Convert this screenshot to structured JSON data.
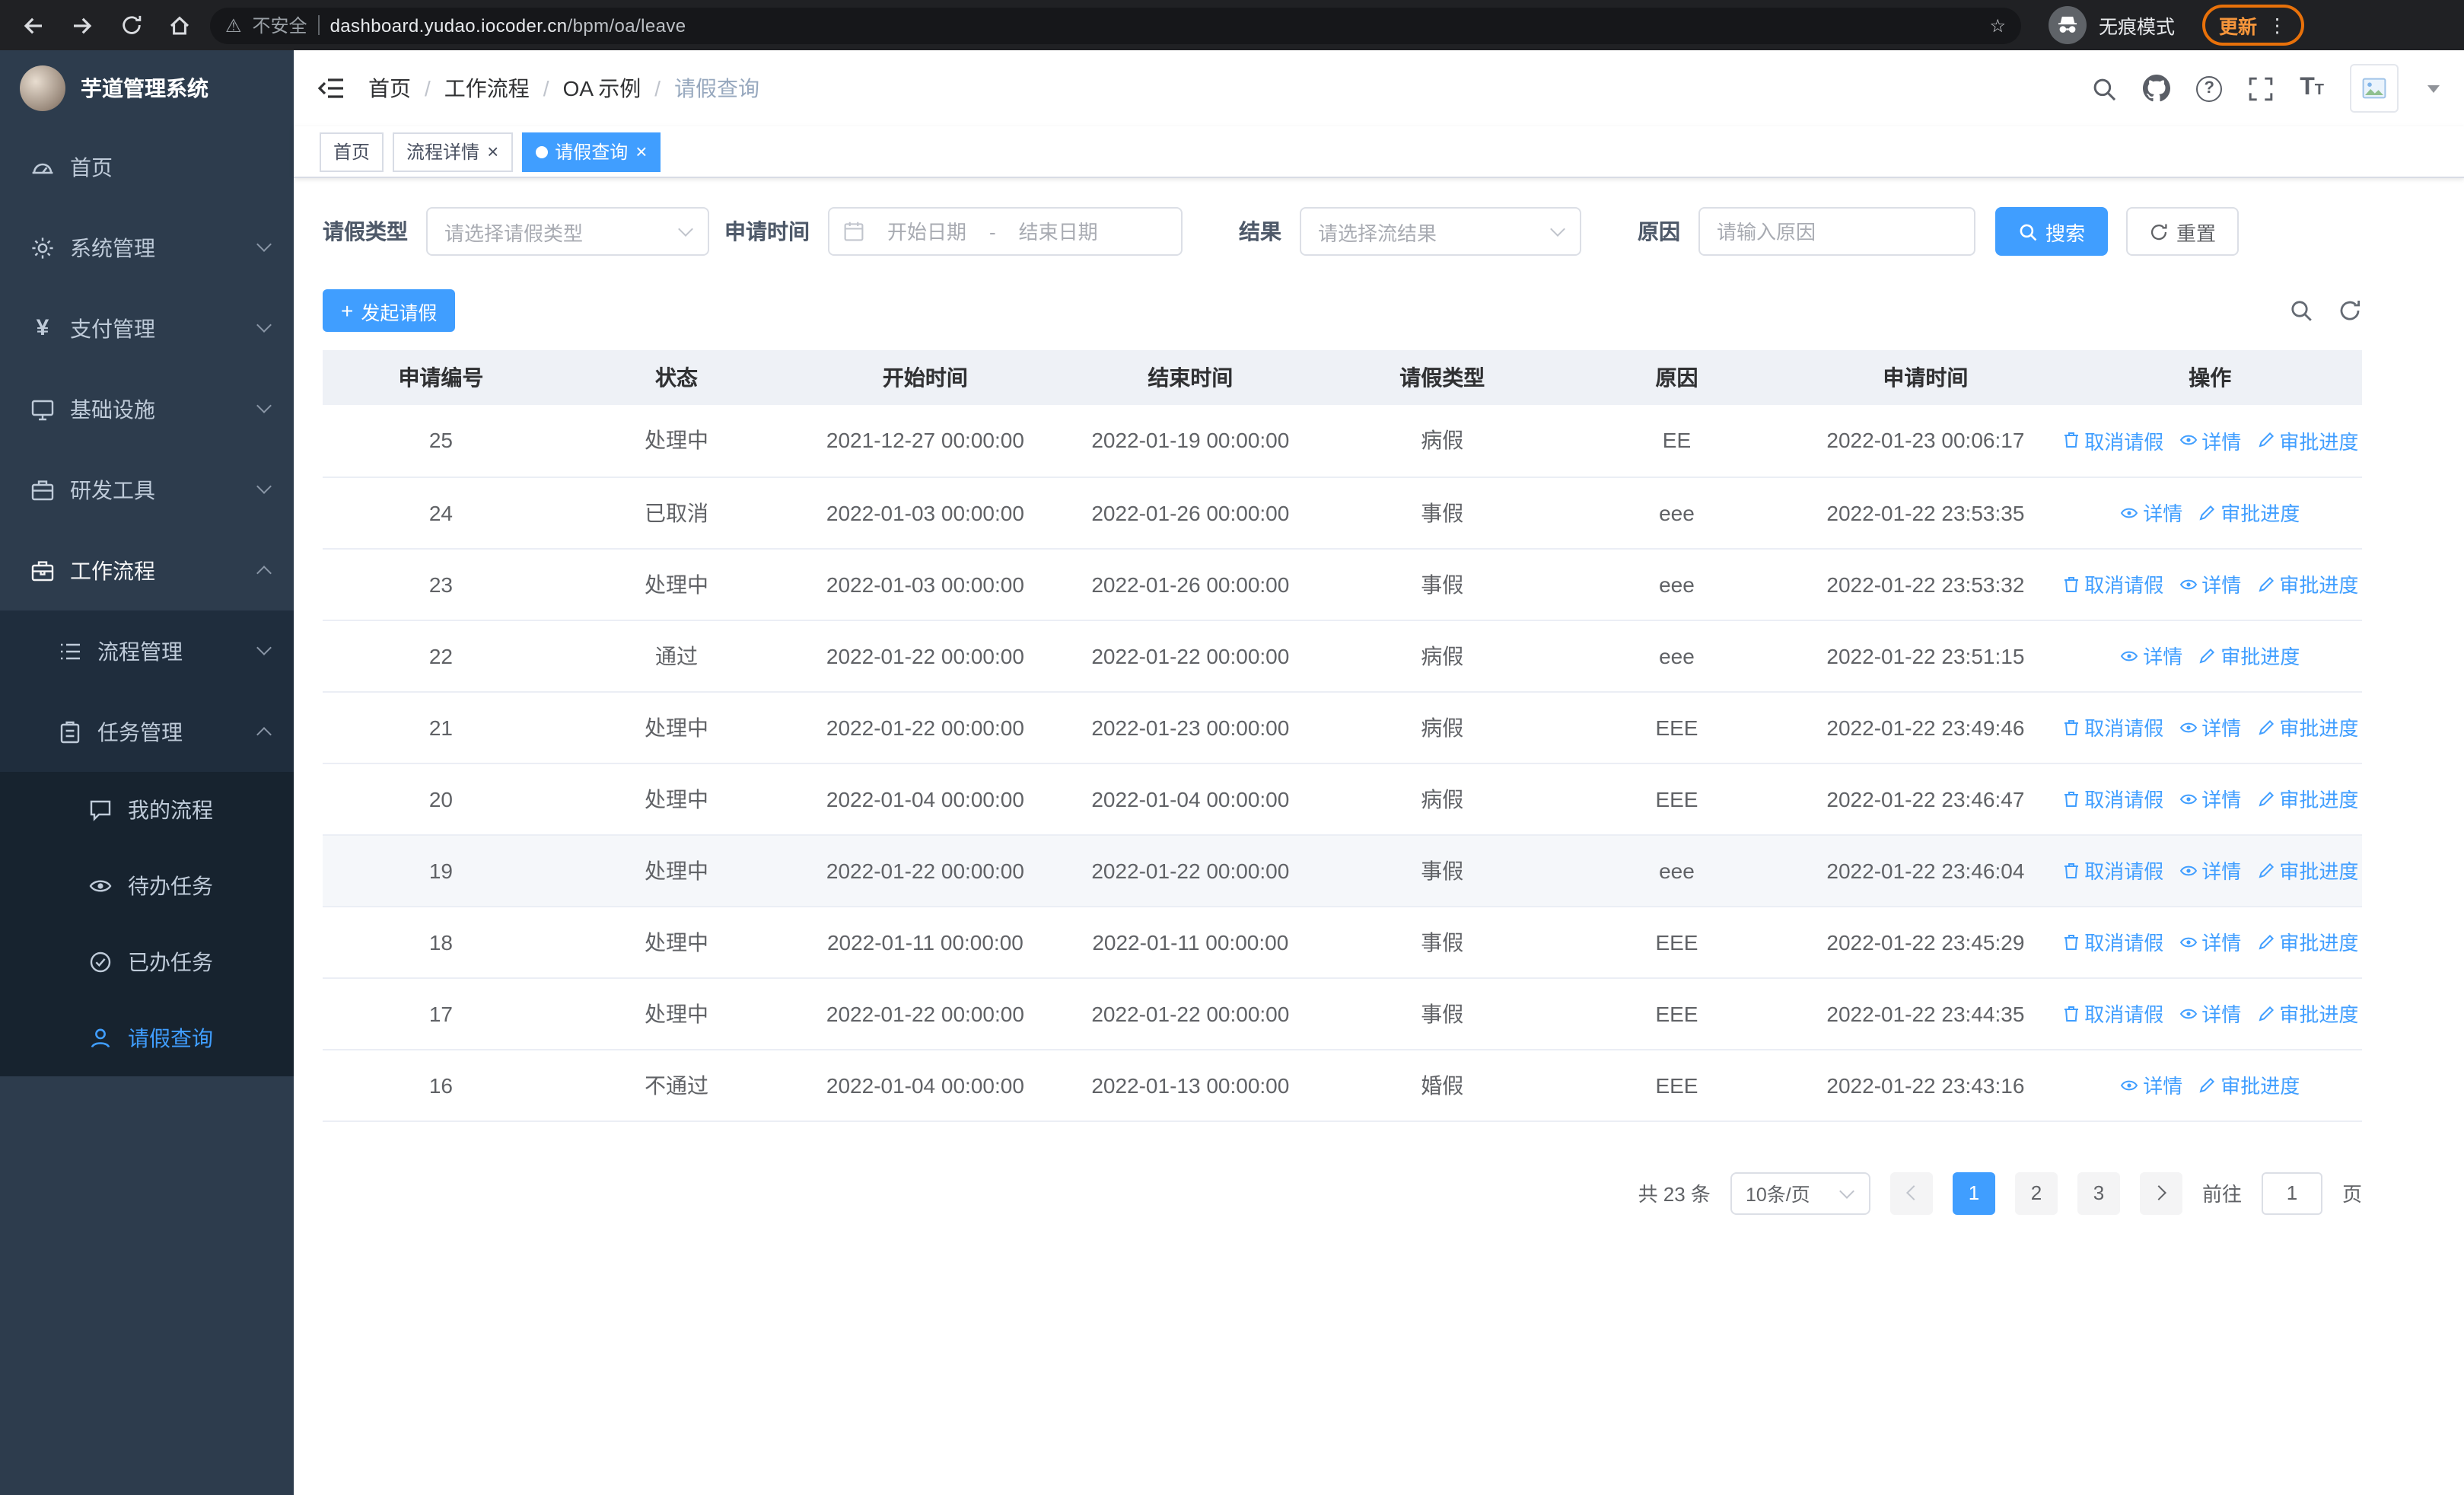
{
  "icons": {
    "warning": "⚠",
    "star": "☆",
    "more": "⋮",
    "yen": "¥",
    "close": "×",
    "plus": "+"
  },
  "browser": {
    "security_label": "不安全",
    "url_domain": "dashboard.yudao.iocoder.cn",
    "url_path": "/bpm/oa/leave",
    "incognito_label": "无痕模式",
    "update_label": "更新"
  },
  "sidebar": {
    "logo_title": "芋道管理系统",
    "items": [
      {
        "label": "首页"
      },
      {
        "label": "系统管理"
      },
      {
        "label": "支付管理"
      },
      {
        "label": "基础设施"
      },
      {
        "label": "研发工具"
      },
      {
        "label": "工作流程"
      }
    ],
    "workflow_children": [
      {
        "label": "流程管理"
      },
      {
        "label": "任务管理"
      }
    ],
    "task_children": [
      {
        "label": "我的流程"
      },
      {
        "label": "待办任务"
      },
      {
        "label": "已办任务"
      },
      {
        "label": "请假查询"
      }
    ]
  },
  "header": {
    "breadcrumb": [
      "首页",
      "工作流程",
      "OA 示例",
      "请假查询"
    ]
  },
  "tabs": [
    {
      "label": "首页"
    },
    {
      "label": "流程详情"
    },
    {
      "label": "请假查询"
    }
  ],
  "filters": {
    "leave_type_label": "请假类型",
    "leave_type_placeholder": "请选择请假类型",
    "time_label": "申请时间",
    "start_placeholder": "开始日期",
    "range_separator": "-",
    "end_placeholder": "结束日期",
    "result_label": "结果",
    "result_placeholder": "请选择流结果",
    "reason_label": "原因",
    "reason_placeholder": "请输入原因",
    "search_label": "搜索",
    "reset_label": "重置"
  },
  "toolbar": {
    "create_label": "发起请假"
  },
  "table": {
    "headers": [
      "申请编号",
      "状态",
      "开始时间",
      "结束时间",
      "请假类型",
      "原因",
      "申请时间",
      "操作"
    ],
    "ops": {
      "cancel": "取消请假",
      "detail": "详情",
      "progress": "审批进度"
    },
    "rows": [
      {
        "id": "25",
        "status": "处理中",
        "start": "2021-12-27 00:00:00",
        "end": "2022-01-19 00:00:00",
        "type": "病假",
        "reason": "EE",
        "applied": "2022-01-23 00:06:17",
        "can_cancel": true
      },
      {
        "id": "24",
        "status": "已取消",
        "start": "2022-01-03 00:00:00",
        "end": "2022-01-26 00:00:00",
        "type": "事假",
        "reason": "eee",
        "applied": "2022-01-22 23:53:35",
        "can_cancel": false
      },
      {
        "id": "23",
        "status": "处理中",
        "start": "2022-01-03 00:00:00",
        "end": "2022-01-26 00:00:00",
        "type": "事假",
        "reason": "eee",
        "applied": "2022-01-22 23:53:32",
        "can_cancel": true
      },
      {
        "id": "22",
        "status": "通过",
        "start": "2022-01-22 00:00:00",
        "end": "2022-01-22 00:00:00",
        "type": "病假",
        "reason": "eee",
        "applied": "2022-01-22 23:51:15",
        "can_cancel": false
      },
      {
        "id": "21",
        "status": "处理中",
        "start": "2022-01-22 00:00:00",
        "end": "2022-01-23 00:00:00",
        "type": "病假",
        "reason": "EEE",
        "applied": "2022-01-22 23:49:46",
        "can_cancel": true
      },
      {
        "id": "20",
        "status": "处理中",
        "start": "2022-01-04 00:00:00",
        "end": "2022-01-04 00:00:00",
        "type": "病假",
        "reason": "EEE",
        "applied": "2022-01-22 23:46:47",
        "can_cancel": true
      },
      {
        "id": "19",
        "status": "处理中",
        "start": "2022-01-22 00:00:00",
        "end": "2022-01-22 00:00:00",
        "type": "事假",
        "reason": "eee",
        "applied": "2022-01-22 23:46:04",
        "can_cancel": true
      },
      {
        "id": "18",
        "status": "处理中",
        "start": "2022-01-11 00:00:00",
        "end": "2022-01-11 00:00:00",
        "type": "事假",
        "reason": "EEE",
        "applied": "2022-01-22 23:45:29",
        "can_cancel": true
      },
      {
        "id": "17",
        "status": "处理中",
        "start": "2022-01-22 00:00:00",
        "end": "2022-01-22 00:00:00",
        "type": "事假",
        "reason": "EEE",
        "applied": "2022-01-22 23:44:35",
        "can_cancel": true
      },
      {
        "id": "16",
        "status": "不通过",
        "start": "2022-01-04 00:00:00",
        "end": "2022-01-13 00:00:00",
        "type": "婚假",
        "reason": "EEE",
        "applied": "2022-01-22 23:43:16",
        "can_cancel": false
      }
    ]
  },
  "pagination": {
    "total": "共 23 条",
    "page_size": "10条/页",
    "pages": [
      "1",
      "2",
      "3"
    ],
    "active_page": "1",
    "goto_label": "前往",
    "goto_value": "1",
    "page_unit": "页"
  },
  "colors": {
    "primary": "#409eff",
    "sidebar_bg": "#2d3c4d",
    "submenu_bg": "#1f2d3d"
  }
}
